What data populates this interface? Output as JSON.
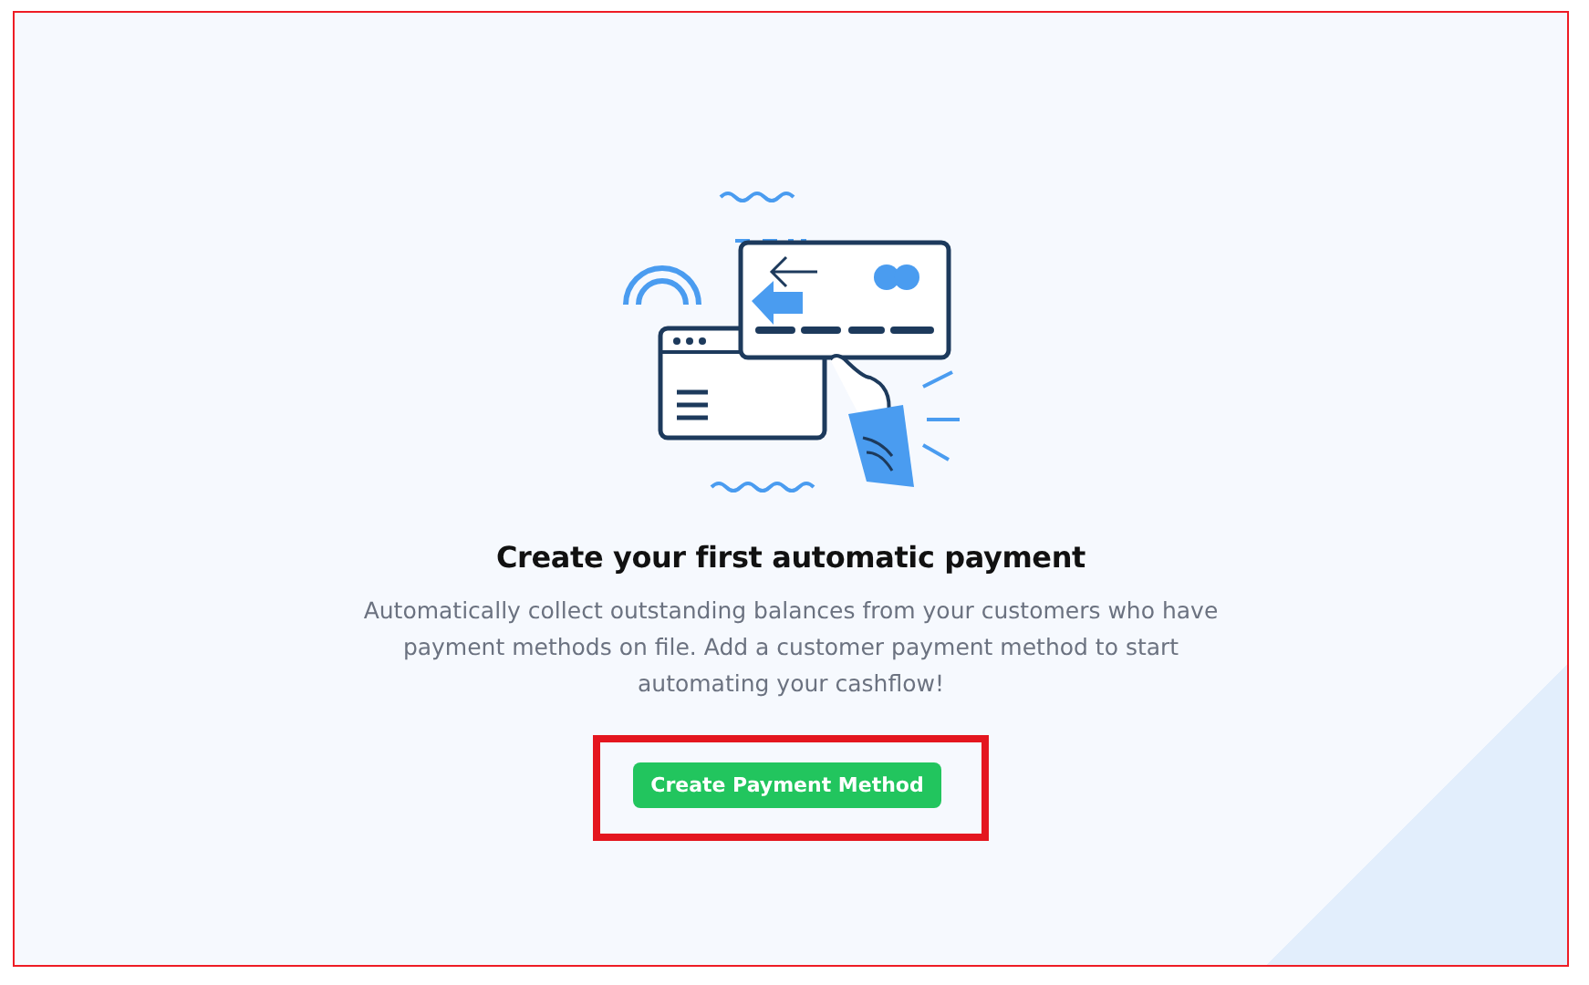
{
  "empty_state": {
    "title": "Create your first automatic payment",
    "description": "Automatically collect outstanding balances from your customers who have payment methods on file. Add a customer payment method to start automating your cashflow!",
    "button": {
      "label": "Create Payment Method",
      "highlighted": true
    }
  }
}
